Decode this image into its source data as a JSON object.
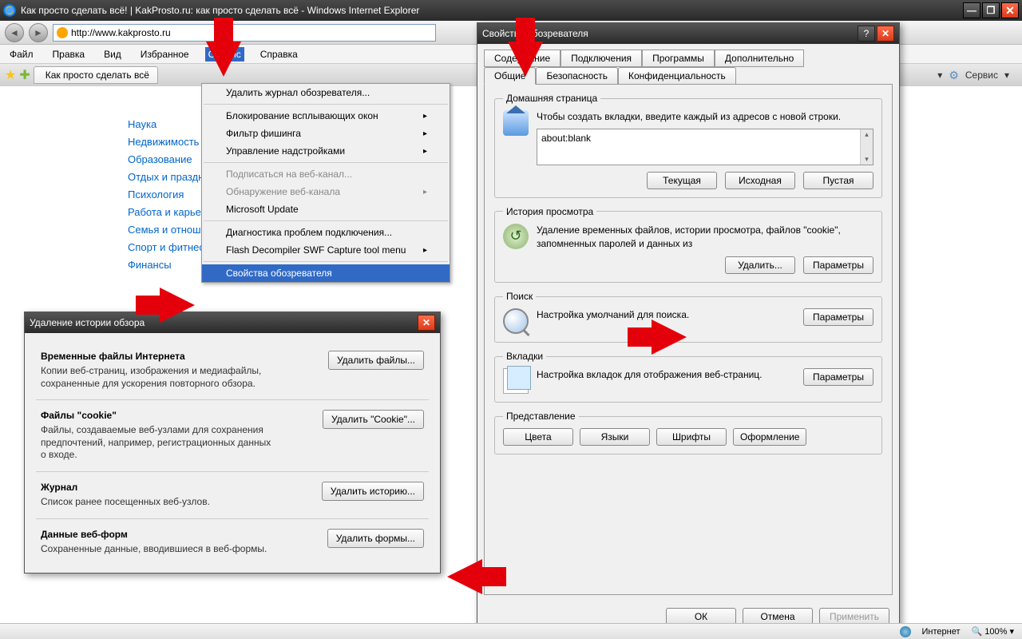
{
  "window": {
    "title": "Как просто сделать всё! | KakProsto.ru: как просто сделать всё - Windows Internet Explorer",
    "url": "http://www.kakprosto.ru"
  },
  "menubar": [
    "Файл",
    "Правка",
    "Вид",
    "Избранное",
    "Сервис",
    "Справка"
  ],
  "active_menu_index": 4,
  "tab": {
    "title": "Как просто сделать всё"
  },
  "toolbar": {
    "service": "Сервис"
  },
  "dropdown": {
    "items": [
      {
        "label": "Удалить журнал обозревателя...",
        "type": "item"
      },
      {
        "type": "sep"
      },
      {
        "label": "Блокирование всплывающих окон",
        "type": "sub"
      },
      {
        "label": "Фильтр фишинга",
        "type": "sub"
      },
      {
        "label": "Управление надстройками",
        "type": "sub"
      },
      {
        "type": "sep"
      },
      {
        "label": "Подписаться на веб-канал...",
        "type": "disabled"
      },
      {
        "label": "Обнаружение веб-канала",
        "type": "disabled-sub"
      },
      {
        "label": "Microsoft Update",
        "type": "item"
      },
      {
        "type": "sep"
      },
      {
        "label": "Диагностика проблем подключения...",
        "type": "item"
      },
      {
        "label": "Flash Decompiler SWF Capture tool menu",
        "type": "sub"
      },
      {
        "type": "sep"
      },
      {
        "label": "Свойства обозревателя",
        "type": "highlight"
      }
    ]
  },
  "sidebar_links": [
    "Наука",
    "Недвижимость",
    "Образование",
    "Отдых и праздники",
    "Психология",
    "Работа и карьера",
    "Семья и отношения",
    "Спорт и фитнес",
    "Финансы"
  ],
  "delete_dialog": {
    "title": "Удаление истории обзора",
    "sections": [
      {
        "h": "Временные файлы Интернета",
        "p": "Копии веб-страниц, изображения и медиафайлы, сохраненные для ускорения повторного обзора.",
        "btn": "Удалить файлы..."
      },
      {
        "h": "Файлы \"cookie\"",
        "p": "Файлы, создаваемые веб-узлами для сохранения предпочтений, например, регистрационных данных о входе.",
        "btn": "Удалить \"Cookie\"..."
      },
      {
        "h": "Журнал",
        "p": "Список ранее посещенных веб-узлов.",
        "btn": "Удалить историю..."
      },
      {
        "h": "Данные веб-форм",
        "p": "Сохраненные данные, вводившиеся в веб-формы.",
        "btn": "Удалить формы..."
      }
    ]
  },
  "options_dialog": {
    "title": "Свойства обозревателя",
    "tabs_row1": [
      "Содержание",
      "Подключения",
      "Программы",
      "Дополнительно"
    ],
    "tabs_row2": [
      "Общие",
      "Безопасность",
      "Конфиденциальность"
    ],
    "active_tab": "Общие",
    "home": {
      "legend": "Домашняя страница",
      "text": "Чтобы создать вкладки, введите каждый из адресов с новой строки.",
      "value": "about:blank",
      "btns": [
        "Текущая",
        "Исходная",
        "Пустая"
      ]
    },
    "history": {
      "legend": "История просмотра",
      "text": "Удаление временных файлов, истории просмотра, файлов \"cookie\", запомненных паролей и данных из",
      "btns": [
        "Удалить...",
        "Параметры"
      ]
    },
    "search": {
      "legend": "Поиск",
      "text": "Настройка умолчаний для поиска.",
      "btn": "Параметры"
    },
    "tabs": {
      "legend": "Вкладки",
      "text": "Настройка вкладок для отображения веб-страниц.",
      "btn": "Параметры"
    },
    "appearance": {
      "legend": "Представление",
      "btns": [
        "Цвета",
        "Языки",
        "Шрифты",
        "Оформление"
      ]
    },
    "footer": [
      "ОК",
      "Отмена",
      "Применить"
    ]
  },
  "statusbar": {
    "zone": "Интернет",
    "zoom": "100%"
  }
}
